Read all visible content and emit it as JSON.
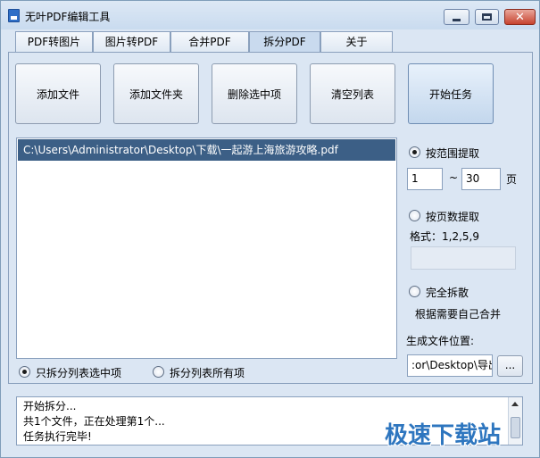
{
  "window": {
    "title": "无叶PDF编辑工具"
  },
  "tabs": [
    {
      "label": "PDF转图片",
      "active": false
    },
    {
      "label": "图片转PDF",
      "active": false
    },
    {
      "label": "合并PDF",
      "active": false
    },
    {
      "label": "拆分PDF",
      "active": true
    },
    {
      "label": "关于",
      "active": false
    }
  ],
  "toolbar": {
    "add_file": "添加文件",
    "add_folder": "添加文件夹",
    "delete_selected": "删除选中项",
    "clear_list": "清空列表",
    "start_task": "开始任务"
  },
  "file_list": {
    "items": [
      "C:\\Users\\Administrator\\Desktop\\下载\\一起游上海旅游攻略.pdf"
    ]
  },
  "scope": {
    "selected_only": "只拆分列表选中项",
    "all_items": "拆分列表所有项",
    "selected": "selected_only"
  },
  "split_options": {
    "by_range": {
      "label": "按范围提取",
      "checked": true,
      "from": "1",
      "tilde": "~",
      "to": "30",
      "unit": "页"
    },
    "by_pages": {
      "label": "按页数提取",
      "checked": false,
      "format_label": "格式：1,2,5,9"
    },
    "full": {
      "label": "完全拆散",
      "checked": false,
      "note": "根据需要自己合并"
    }
  },
  "output": {
    "label": "生成文件位置:",
    "path": ":or\\Desktop\\导出",
    "browse": "..."
  },
  "log": {
    "lines": [
      "开始拆分...",
      "共1个文件，正在处理第1个...",
      "任务执行完毕!"
    ]
  },
  "watermark": "极速下载站",
  "colors": {
    "window_bg": "#dbe6f3",
    "selection": "#3c5f86",
    "watermark": "#2e76bf",
    "close_button": "#c7432f"
  }
}
